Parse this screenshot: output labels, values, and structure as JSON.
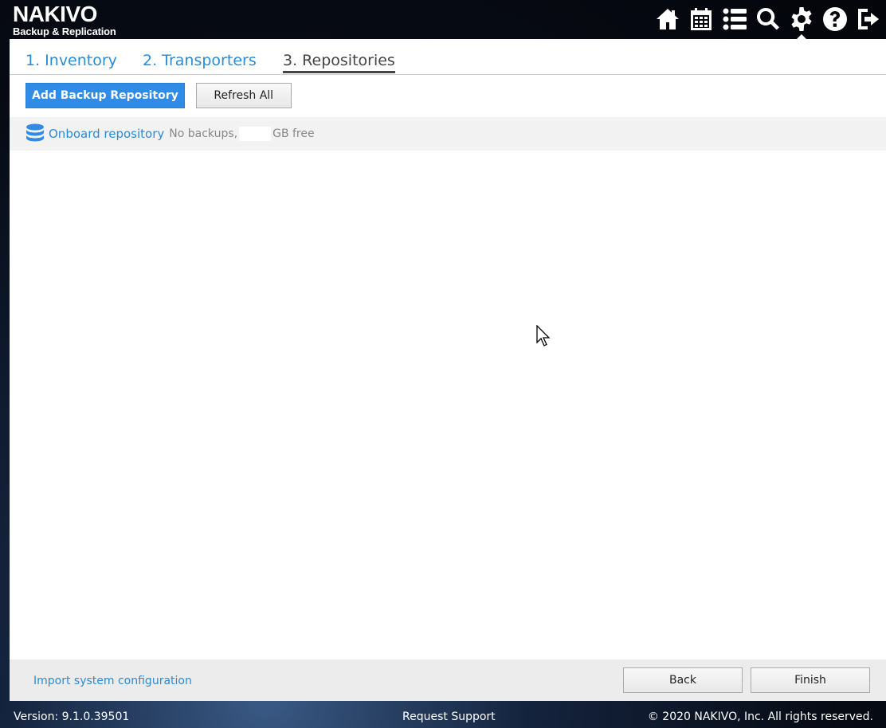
{
  "app": {
    "brand": "NAKIVO",
    "subtitle": "Backup & Replication"
  },
  "header": {
    "icons": [
      "home-icon",
      "calendar-icon",
      "list-icon",
      "search-icon",
      "gear-icon",
      "help-icon",
      "logout-icon"
    ],
    "active_icon": "gear-icon"
  },
  "tabs": [
    {
      "label": "1. Inventory",
      "active": false
    },
    {
      "label": "2. Transporters",
      "active": false
    },
    {
      "label": "3. Repositories",
      "active": true
    }
  ],
  "toolbar": {
    "add_label": "Add Backup Repository",
    "refresh_label": "Refresh All"
  },
  "repository": {
    "name": "Onboard repository",
    "info_prefix": "No backups,",
    "info_suffix": "GB free",
    "icon": "database-icon"
  },
  "footer": {
    "import_label": "Import system configuration",
    "back_label": "Back",
    "finish_label": "Finish"
  },
  "status": {
    "version": "Version: 9.1.0.39501",
    "support": "Request Support",
    "copyright": "© 2020 NAKIVO, Inc. All rights reserved."
  },
  "colors": {
    "accent": "#2f8be6",
    "link": "#2a8bd6",
    "active_tab": "#444444"
  }
}
